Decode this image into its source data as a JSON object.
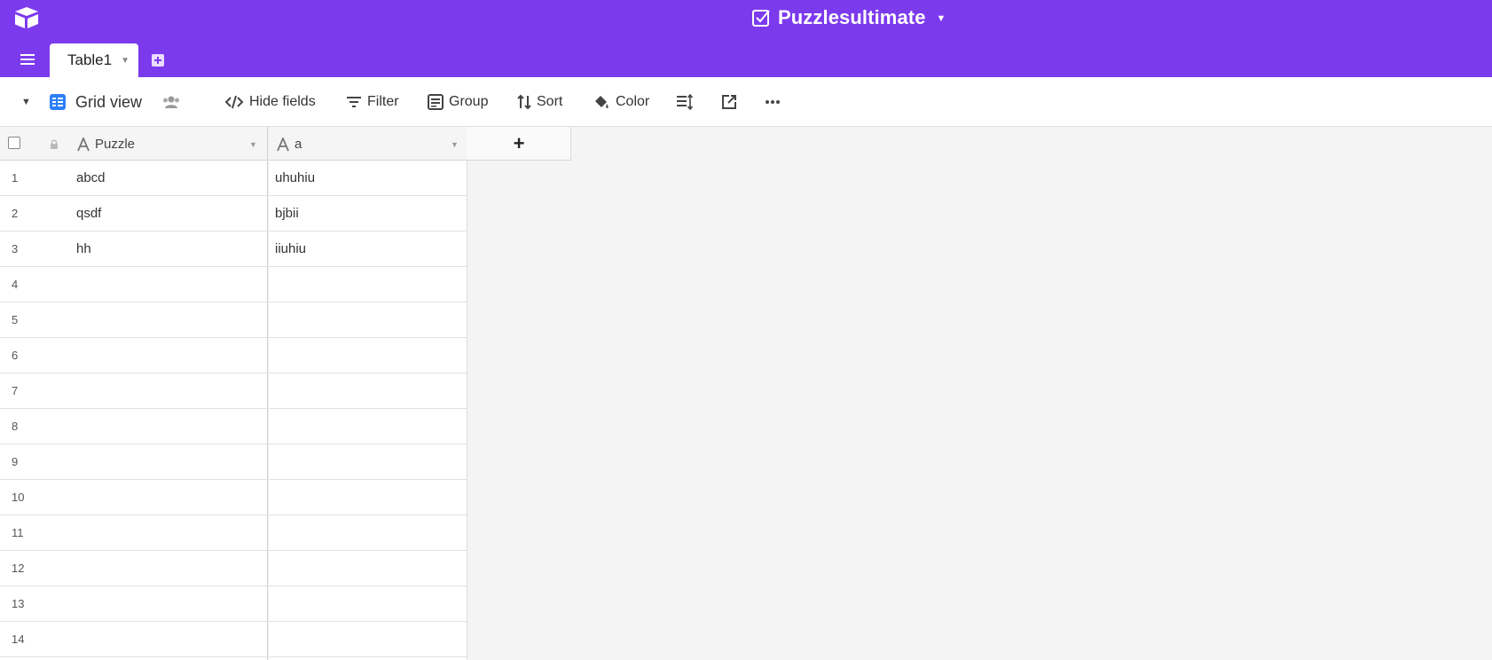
{
  "header": {
    "base_name": "Puzzlesultimate",
    "tab_label": "Table1"
  },
  "toolbar": {
    "view_name": "Grid view",
    "hide_fields": "Hide fields",
    "filter": "Filter",
    "group": "Group",
    "sort": "Sort",
    "color": "Color"
  },
  "grid": {
    "columns": [
      "Puzzle",
      "a"
    ],
    "add_field_label": "+",
    "rows": [
      {
        "num": "1",
        "puzzle": "abcd",
        "a": "uhuhiu"
      },
      {
        "num": "2",
        "puzzle": "qsdf",
        "a": "bjbii"
      },
      {
        "num": "3",
        "puzzle": "hh",
        "a": "iiuhiu"
      },
      {
        "num": "4",
        "puzzle": "",
        "a": ""
      },
      {
        "num": "5",
        "puzzle": "",
        "a": ""
      },
      {
        "num": "6",
        "puzzle": "",
        "a": ""
      },
      {
        "num": "7",
        "puzzle": "",
        "a": ""
      },
      {
        "num": "8",
        "puzzle": "",
        "a": ""
      },
      {
        "num": "9",
        "puzzle": "",
        "a": ""
      },
      {
        "num": "10",
        "puzzle": "",
        "a": ""
      },
      {
        "num": "11",
        "puzzle": "",
        "a": ""
      },
      {
        "num": "12",
        "puzzle": "",
        "a": ""
      },
      {
        "num": "13",
        "puzzle": "",
        "a": ""
      },
      {
        "num": "14",
        "puzzle": "",
        "a": ""
      }
    ]
  },
  "colors": {
    "brand_purple": "#7c3aed",
    "grid_view_icon": "#2d7ff9"
  }
}
